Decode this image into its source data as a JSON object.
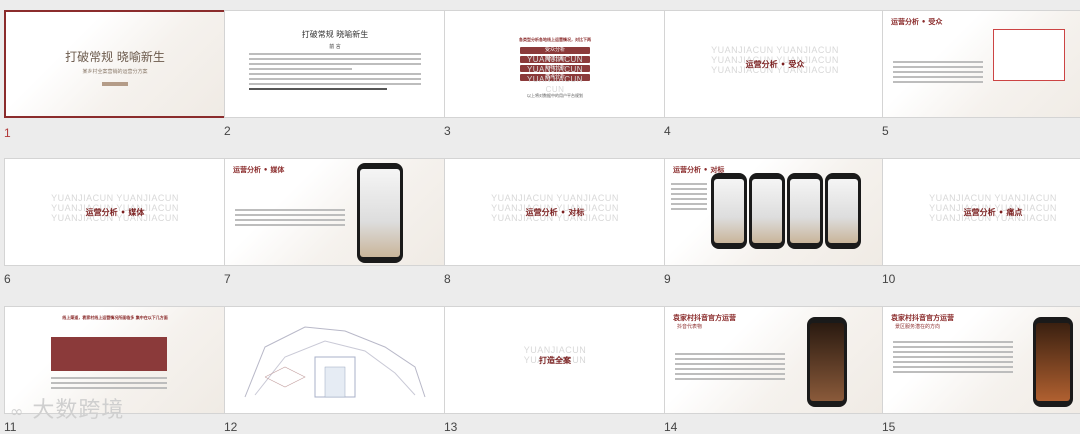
{
  "slides": [
    {
      "num": "1",
      "title": "打破常规 晓喻新生",
      "subtitle": "某乡村全案营销的运营分方案",
      "selected": true
    },
    {
      "num": "2",
      "title": "打破常规 晓喻新生",
      "heading": "前 言"
    },
    {
      "num": "3",
      "title": "各类型分析各地线上运营情况，对比下两",
      "bars": [
        "受众分析",
        "媒体分析",
        "对标分析",
        "痛点分析"
      ],
      "footer": "以上将对数据中的用户平台规划"
    },
    {
      "num": "4",
      "watermark": "YUANJIACUN YUANJIACUN",
      "label": "运营分析 • 受众"
    },
    {
      "num": "5",
      "title": "运营分析 • 受众"
    },
    {
      "num": "6",
      "watermark": "YUANJIACUN YUANJIACUN",
      "label": "运营分析 • 媒体"
    },
    {
      "num": "7",
      "title": "运营分析 • 媒体"
    },
    {
      "num": "8",
      "watermark": "YUANJIACUN YUANJIACUN",
      "label": "运营分析 • 对标"
    },
    {
      "num": "9",
      "title": "运营分析 • 对标"
    },
    {
      "num": "10",
      "watermark": "YUANJIACUN YUANJIACUN",
      "label": "运营分析 • 痛点"
    },
    {
      "num": "11",
      "title": "线上渠道，袁家村线上运营情况所面临多 集中在以下几方面"
    },
    {
      "num": "12"
    },
    {
      "num": "13",
      "label": "打造全案"
    },
    {
      "num": "14",
      "title": "袁家村抖音官方运营",
      "subtitle": "抖音代表物"
    },
    {
      "num": "15",
      "title": "袁家村抖音官方运营",
      "subtitle": "景区服务潜在的方向"
    }
  ],
  "logo_text": "大数跨境"
}
